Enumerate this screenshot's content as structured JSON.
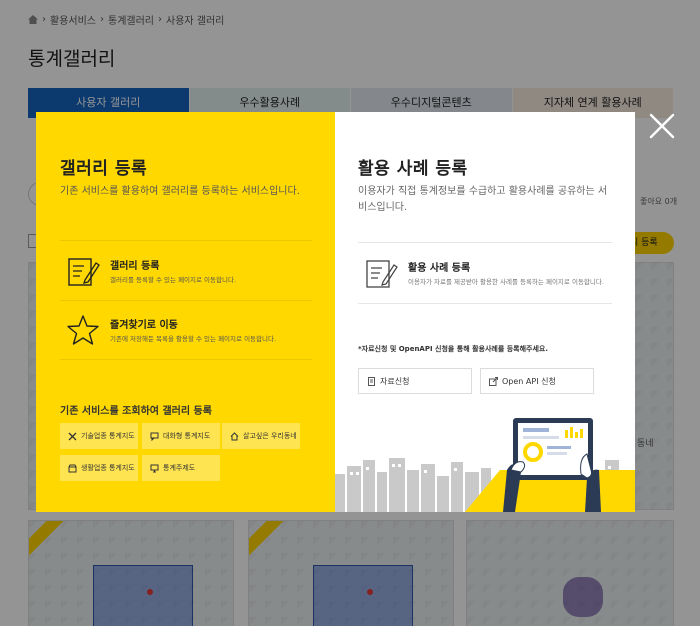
{
  "background": {
    "breadcrumb": [
      "활용서비스",
      "통계갤러리",
      "사용자 갤러리"
    ],
    "page_title": "통계갤러리",
    "tabs": [
      "사용자 갤러리",
      "우수활용사례",
      "우수디지털콘텐츠",
      "지자체 연계 활용사례"
    ],
    "side_count_text": "좋아요 0개",
    "register_button_partial": "리 등록",
    "side_label": "동네"
  },
  "modal": {
    "left": {
      "title": "갤러리 등록",
      "desc": "기존 서비스를 활용하여 갤러리를 등록하는 서비스입니다.",
      "features": [
        {
          "title": "갤러리 등록",
          "desc": "갤러리를 등록할 수 있는 페이지로 이동합니다.",
          "icon": "edit-document-icon"
        },
        {
          "title": "즐겨찾기로 이동",
          "desc": "기존에 저장해둔 목록을 활용할 수 있는 페이지로 이동합니다.",
          "icon": "star-icon"
        }
      ],
      "lookup_title": "기존 서비스를 조회하여 갤러리 등록",
      "services": [
        "기술업종 통계지도",
        "대화형 통계지도",
        "살고싶은 우리동네",
        "생활업종 통계지도",
        "통계주제도"
      ]
    },
    "right": {
      "title": "활용 사례 등록",
      "desc": "이용자가 직접 통계정보를 수급하고 활용사례를 공유하는 서비스입니다.",
      "feature": {
        "title": "활용 사례 등록",
        "desc": "이용자가 자료를 제공받아 활용한 사례를 등록하는 페이지로 이동합니다.",
        "icon": "edit-document-icon"
      },
      "note": "*자료신청 및 OpenAPI 신청을 통해 활용사례를 등록해주세요.",
      "buttons": [
        "자료신청",
        "Open API 신청"
      ]
    }
  },
  "colors": {
    "accent_yellow": "#ffd800",
    "tab_blue": "#1565c0"
  }
}
